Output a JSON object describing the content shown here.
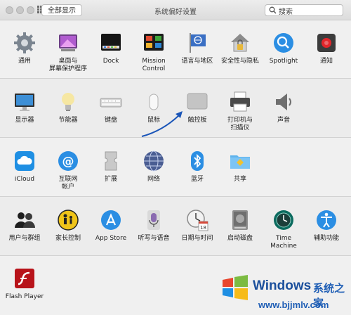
{
  "window": {
    "title": "系统偏好设置",
    "show_all_label": "全部显示",
    "search_placeholder": "搜索"
  },
  "rows": [
    [
      {
        "label": "通用",
        "icon": "gear-icon"
      },
      {
        "label": "桌面与\n屏幕保护程序",
        "icon": "desktop-icon"
      },
      {
        "label": "Dock",
        "icon": "dock-icon"
      },
      {
        "label": "Mission\nControl",
        "icon": "mission-control-icon"
      },
      {
        "label": "语言与地区",
        "icon": "flag-icon"
      },
      {
        "label": "安全性与隐私",
        "icon": "house-lock-icon"
      },
      {
        "label": "Spotlight",
        "icon": "magnifier-icon"
      },
      {
        "label": "通知",
        "icon": "notifications-icon"
      }
    ],
    [
      {
        "label": "显示器",
        "icon": "display-icon"
      },
      {
        "label": "节能器",
        "icon": "lightbulb-icon"
      },
      {
        "label": "键盘",
        "icon": "keyboard-icon"
      },
      {
        "label": "鼠标",
        "icon": "mouse-icon"
      },
      {
        "label": "触控板",
        "icon": "trackpad-icon"
      },
      {
        "label": "打印机与\n扫描仪",
        "icon": "printer-icon"
      },
      {
        "label": "声音",
        "icon": "speaker-icon"
      }
    ],
    [
      {
        "label": "iCloud",
        "icon": "icloud-icon"
      },
      {
        "label": "互联网\n帐户",
        "icon": "at-sign-icon"
      },
      {
        "label": "扩展",
        "icon": "extensions-icon"
      },
      {
        "label": "网络",
        "icon": "globe-icon"
      },
      {
        "label": "蓝牙",
        "icon": "bluetooth-icon"
      },
      {
        "label": "共享",
        "icon": "sharing-folder-icon"
      }
    ],
    [
      {
        "label": "用户与群组",
        "icon": "users-icon"
      },
      {
        "label": "家长控制",
        "icon": "parental-controls-icon"
      },
      {
        "label": "App Store",
        "icon": "app-store-icon"
      },
      {
        "label": "听写与语音",
        "icon": "microphone-icon"
      },
      {
        "label": "日期与时间",
        "icon": "clock-calendar-icon"
      },
      {
        "label": "启动磁盘",
        "icon": "hard-disk-icon"
      },
      {
        "label": "Time Machine",
        "icon": "time-machine-icon"
      },
      {
        "label": "辅助功能",
        "icon": "accessibility-icon"
      }
    ],
    [
      {
        "label": "Flash Player",
        "icon": "flash-icon"
      }
    ]
  ],
  "watermark": {
    "brand": "Windows",
    "sub": "系统之家",
    "url": "www.bjjmlv.com"
  }
}
